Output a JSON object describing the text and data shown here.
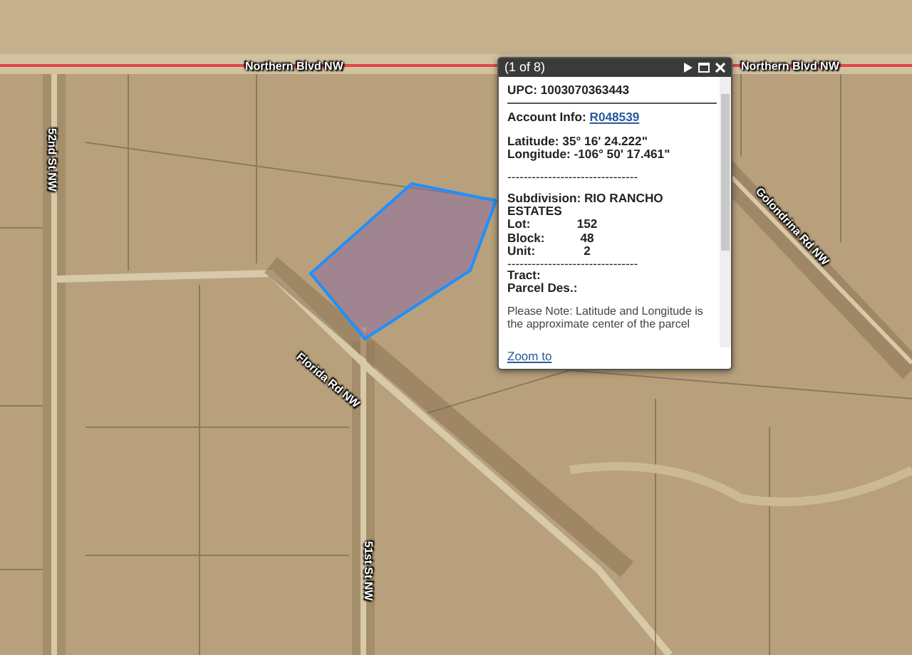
{
  "map": {
    "street_labels": [
      "Northern Blvd NW",
      "Northern Blvd NW",
      "52nd St NW",
      "Florida Rd NW",
      "51st St NW",
      "Golondrina Rd NW"
    ]
  },
  "popup": {
    "title": "(1 of 8)",
    "lines": [
      {
        "kind": "field",
        "label": "UPC:",
        "value": "1003070363443"
      },
      {
        "kind": "rule"
      },
      {
        "kind": "link_field",
        "label": "Account Info:",
        "link": "R048539"
      },
      {
        "kind": "gap"
      },
      {
        "kind": "field",
        "label": "Latitude:",
        "value": "35° 16' 24.222\""
      },
      {
        "kind": "field",
        "label": "Longitude:",
        "value": "-106° 50' 17.461\""
      },
      {
        "kind": "gap"
      },
      {
        "kind": "dashes",
        "text": "--------------------------------"
      },
      {
        "kind": "gap"
      },
      {
        "kind": "field",
        "label": "Subdivision:",
        "value": "RIO RANCHO ESTATES"
      },
      {
        "kind": "column_field",
        "label": "Lot:",
        "value": "152"
      },
      {
        "kind": "column_field",
        "label": "Block:",
        "value": "48"
      },
      {
        "kind": "column_field",
        "label": "Unit:",
        "value": "2"
      },
      {
        "kind": "dashes",
        "text": "--------------------------------"
      },
      {
        "kind": "field",
        "label": "Tract:"
      },
      {
        "kind": "field",
        "label": "Parcel Des.:"
      },
      {
        "kind": "gap"
      },
      {
        "kind": "note",
        "text": "Please Note: Latitude and Longitude is the approximate center of the parcel"
      }
    ],
    "footer_link": "Zoom to"
  }
}
